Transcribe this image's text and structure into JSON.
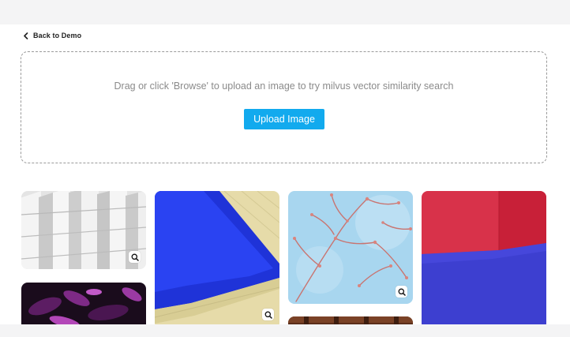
{
  "nav": {
    "back_label": "Back to Demo"
  },
  "upload": {
    "instruction": "Drag or click 'Browse' to upload an image to try milvus vector similarity search",
    "button_label": "Upload Image"
  },
  "gallery": {
    "images": [
      {
        "name": "white-facade"
      },
      {
        "name": "pink-plant"
      },
      {
        "name": "blue-pool"
      },
      {
        "name": "pink-branches"
      },
      {
        "name": "wooden-interior"
      },
      {
        "name": "red-blue-room"
      }
    ],
    "zoom_icon": "zoom-in-icon"
  },
  "colors": {
    "accent": "#12aaee"
  }
}
